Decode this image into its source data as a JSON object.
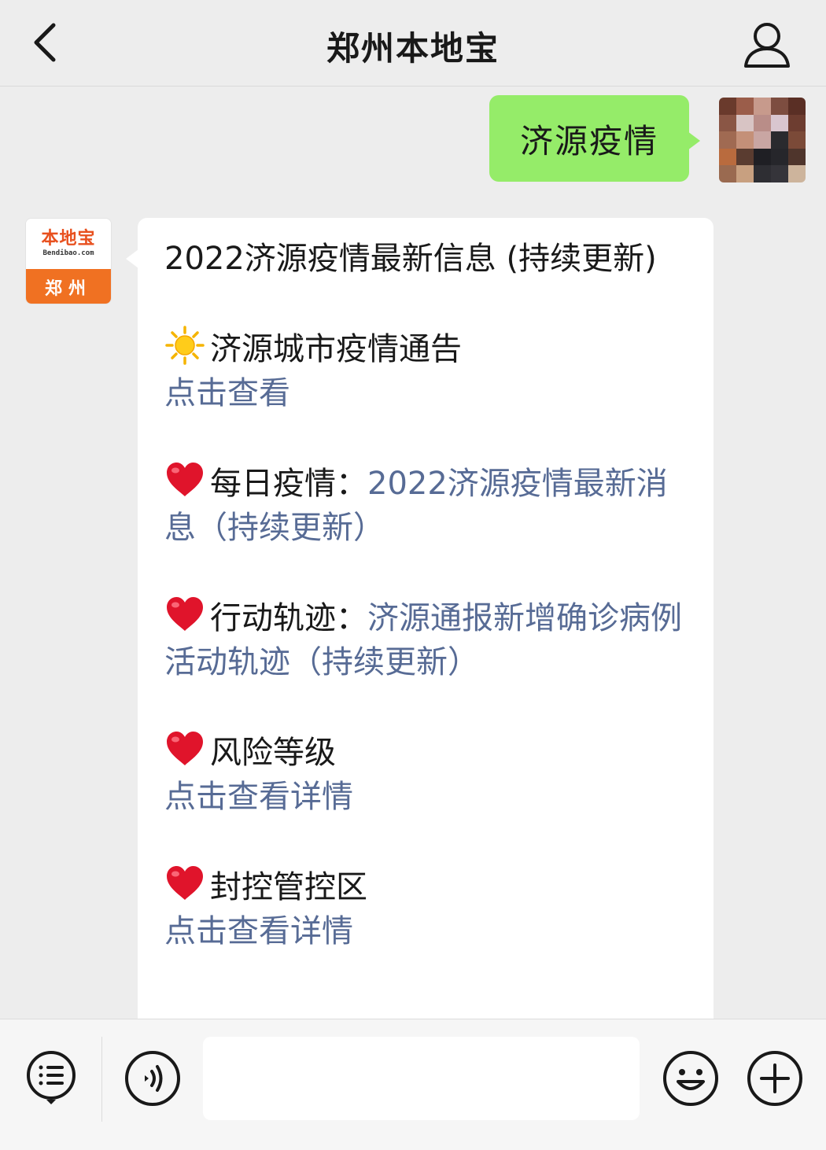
{
  "header": {
    "title": "郑州本地宝"
  },
  "outgoing": {
    "text": "济源疫情"
  },
  "bot_avatar": {
    "brand": "本地宝",
    "domain": "Bendibao.com",
    "city": "郑州"
  },
  "incoming": {
    "title": "2022济源疫情最新信息 (持续更新)",
    "sections": [
      {
        "icon": "sun-emoji",
        "heading": "济源城市疫情通告",
        "separator": "",
        "link": "点击查看",
        "inline": false
      },
      {
        "icon": "heart-emoji",
        "heading": "每日疫情",
        "separator": "：",
        "link": "2022济源疫情最新消息（持续更新）",
        "inline": true
      },
      {
        "icon": "heart-emoji",
        "heading": "行动轨迹",
        "separator": "：",
        "link": "济源通报新增确诊病例活动轨迹（持续更新）",
        "inline": true
      },
      {
        "icon": "heart-emoji",
        "heading": "风险等级",
        "separator": "",
        "link": "点击查看详情",
        "inline": false
      },
      {
        "icon": "heart-emoji",
        "heading": "封控管控区",
        "separator": "",
        "link": "点击查看详情",
        "inline": false
      }
    ]
  },
  "toolbar": {
    "input_value": "",
    "icons": [
      "menu-icon",
      "voice-icon",
      "emoji-icon",
      "plus-icon"
    ]
  },
  "colors": {
    "background": "#ededed",
    "outgoing_bubble": "#95ec69",
    "incoming_bubble": "#ffffff",
    "link": "#576b95",
    "brand_orange": "#f07122"
  }
}
